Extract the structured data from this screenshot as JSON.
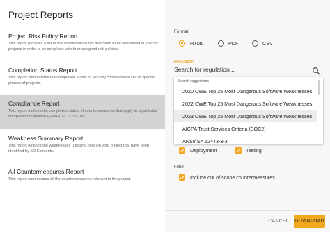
{
  "title": "Project Reports",
  "reports": [
    {
      "title": "Project Risk Policy Report",
      "desc": "This report provides a list of the countermeasures that need to be addressed in specific projects in order to be compliant with their assigned risk policies."
    },
    {
      "title": "Completion Status Report",
      "desc": "This report summarizes the completion status of security countermeasures in specific phases of projects."
    },
    {
      "title": "Compliance Report",
      "desc": "This report outlines the completion status of countermeasures that apply to a particular compliance regulation (HIPAA, PCI DSS, etc)."
    },
    {
      "title": "Weakness Summary Report",
      "desc": "This report outlines the weaknesses (security risks) in your project that have been identified by SD Elements."
    },
    {
      "title": "All Countermeasures Report",
      "desc": "This report summarizes all the countermeasures relevant to the project."
    }
  ],
  "format": {
    "label": "Format",
    "options": [
      "HTML",
      "PDF",
      "CSV"
    ],
    "selected": "HTML"
  },
  "regulation": {
    "label": "Regulation",
    "placeholder": "Search for regulation...",
    "hint": "Search suggestions",
    "options": [
      "2020 CWE Top 25 Most Dangerous Software Weaknesses",
      "2022 CWE Top 25 Most Dangerous Software Weaknesses",
      "2023 CWE Top 25 Most Dangerous Software Weaknesses",
      "AICPA Trust Services Criteria (SOC2)",
      "ANSI/ISA 62443-3-3"
    ],
    "highlighted_index": 2
  },
  "phases": [
    "Deployment",
    "Testing"
  ],
  "filter": {
    "label": "Filter",
    "option": "Include out of scope countermeasures"
  },
  "actions": {
    "cancel": "CANCEL",
    "download": "DOWNLOAD"
  },
  "colors": {
    "accent": "#f2a81d",
    "active_item_bg": "#d3d3d3",
    "right_panel_bg": "#f7f7f7"
  }
}
